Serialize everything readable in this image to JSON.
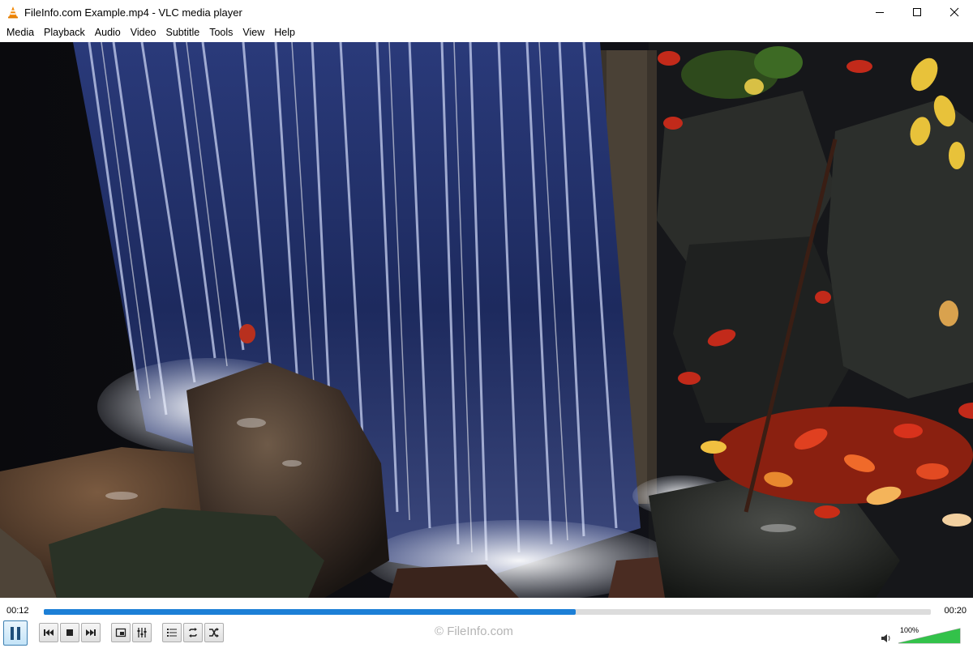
{
  "window": {
    "title": "FileInfo.com Example.mp4 - VLC media player"
  },
  "menu": {
    "items": [
      "Media",
      "Playback",
      "Audio",
      "Video",
      "Subtitle",
      "Tools",
      "View",
      "Help"
    ]
  },
  "playback": {
    "elapsed": "00:12",
    "total": "00:20",
    "progress_fraction": 0.6,
    "state": "playing"
  },
  "controls": {
    "play_pause_icon": "pause-icon",
    "buttons": [
      "previous-icon",
      "stop-icon",
      "next-icon",
      "fullscreen-icon",
      "extended-settings-icon",
      "playlist-icon",
      "loop-icon",
      "shuffle-icon"
    ]
  },
  "watermark": "© FileInfo.com",
  "volume": {
    "label": "100%",
    "level_fraction": 1.0
  },
  "colors": {
    "accent": "#1c7fd6",
    "volume_fill": "#33c24a"
  }
}
